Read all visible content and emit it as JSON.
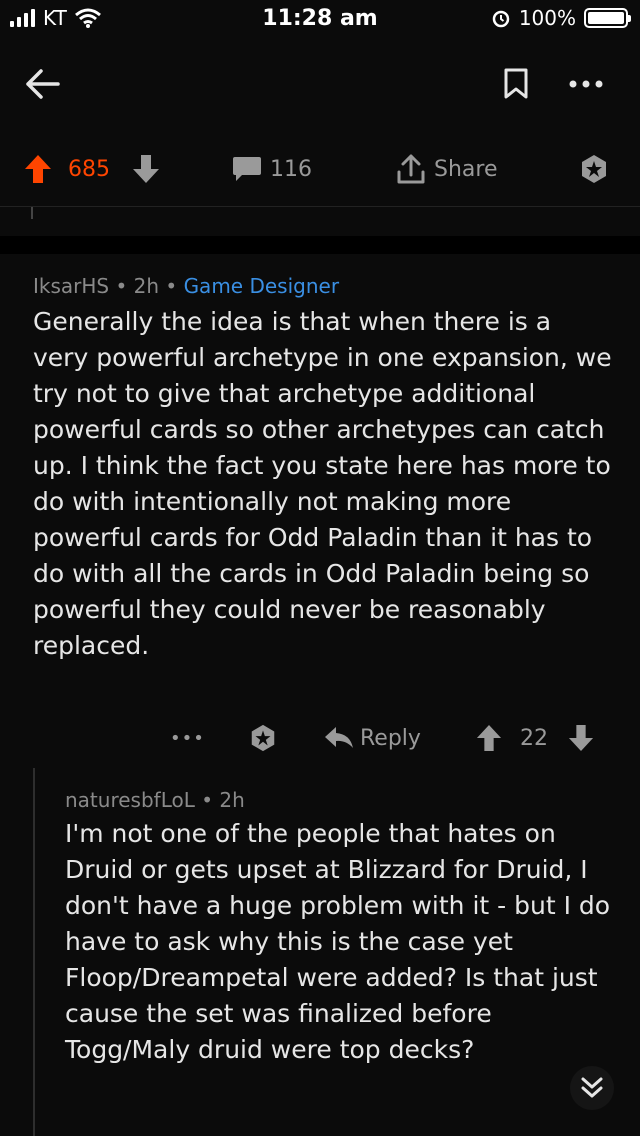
{
  "status_bar": {
    "carrier": "KT",
    "time": "11:28 am",
    "battery": "100%"
  },
  "icons": {
    "back": "arrow-left-icon",
    "save": "bookmark-icon",
    "more": "more-horizontal-icon",
    "upvote": "arrow-up-icon",
    "downvote": "arrow-down-icon",
    "comments": "comment-bubble-icon",
    "share": "share-icon",
    "award": "award-star-icon",
    "reply": "reply-arrow-icon",
    "collapse": "chevron-double-down-icon"
  },
  "colors": {
    "background": "#0b0b0b",
    "upvote_active": "#ff4500",
    "flair": "#3a8fe3",
    "muted": "#8a8a8a"
  },
  "post_actions": {
    "score": "685",
    "comment_count": "116",
    "share_label": "Share"
  },
  "comment": {
    "author": "IksarHS",
    "time": "2h",
    "flair": "Game Designer",
    "body": "Generally the idea is that when there is a very powerful archetype in one expansion, we try not to give that archetype additional powerful cards so other archetypes can catch up. I think the fact you state here has more to do with intentionally not making more powerful cards for Odd Paladin than it has to do with all the cards in Odd Paladin being so powerful they could never be reasonably replaced.",
    "more_label": "•••",
    "reply_label": "Reply",
    "score": "22"
  },
  "reply": {
    "author": "naturesbfLoL",
    "time": "2h",
    "body": "I'm not one of the people that hates on Druid or gets upset at Blizzard for Druid, I don't have a huge problem with it - but I do have to ask why this is the case yet Floop/Dreampetal were added? Is that just cause the set was finalized before Togg/Maly druid were top decks?"
  }
}
